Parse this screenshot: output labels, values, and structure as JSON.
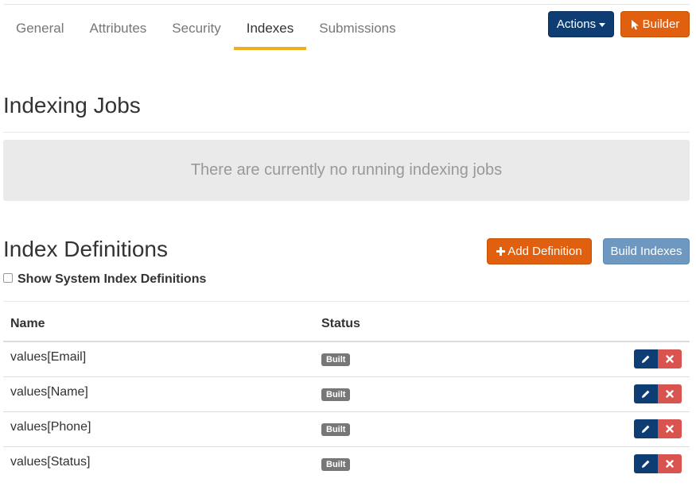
{
  "tabs": [
    {
      "label": "General"
    },
    {
      "label": "Attributes"
    },
    {
      "label": "Security"
    },
    {
      "label": "Indexes",
      "active": true
    },
    {
      "label": "Submissions"
    }
  ],
  "header_buttons": {
    "actions_label": "Actions",
    "builder_label": "Builder"
  },
  "indexing_jobs": {
    "title": "Indexing Jobs",
    "empty_message": "There are currently no running indexing jobs"
  },
  "index_definitions": {
    "title": "Index Definitions",
    "add_label": "Add Definition",
    "build_label": "Build Indexes",
    "show_system_label": "Show System Index Definitions",
    "show_system_checked": false,
    "columns": {
      "name": "Name",
      "status": "Status"
    },
    "rows": [
      {
        "name": "values[Email]",
        "status": "Built"
      },
      {
        "name": "values[Name]",
        "status": "Built"
      },
      {
        "name": "values[Phone]",
        "status": "Built"
      },
      {
        "name": "values[Status]",
        "status": "Built"
      }
    ]
  },
  "colors": {
    "primary": "#0e3d73",
    "accent_orange": "#e0600f",
    "tab_underline": "#f0ad1e",
    "build_button": "#6e98bf",
    "danger": "#d9534f",
    "badge": "#777777"
  }
}
